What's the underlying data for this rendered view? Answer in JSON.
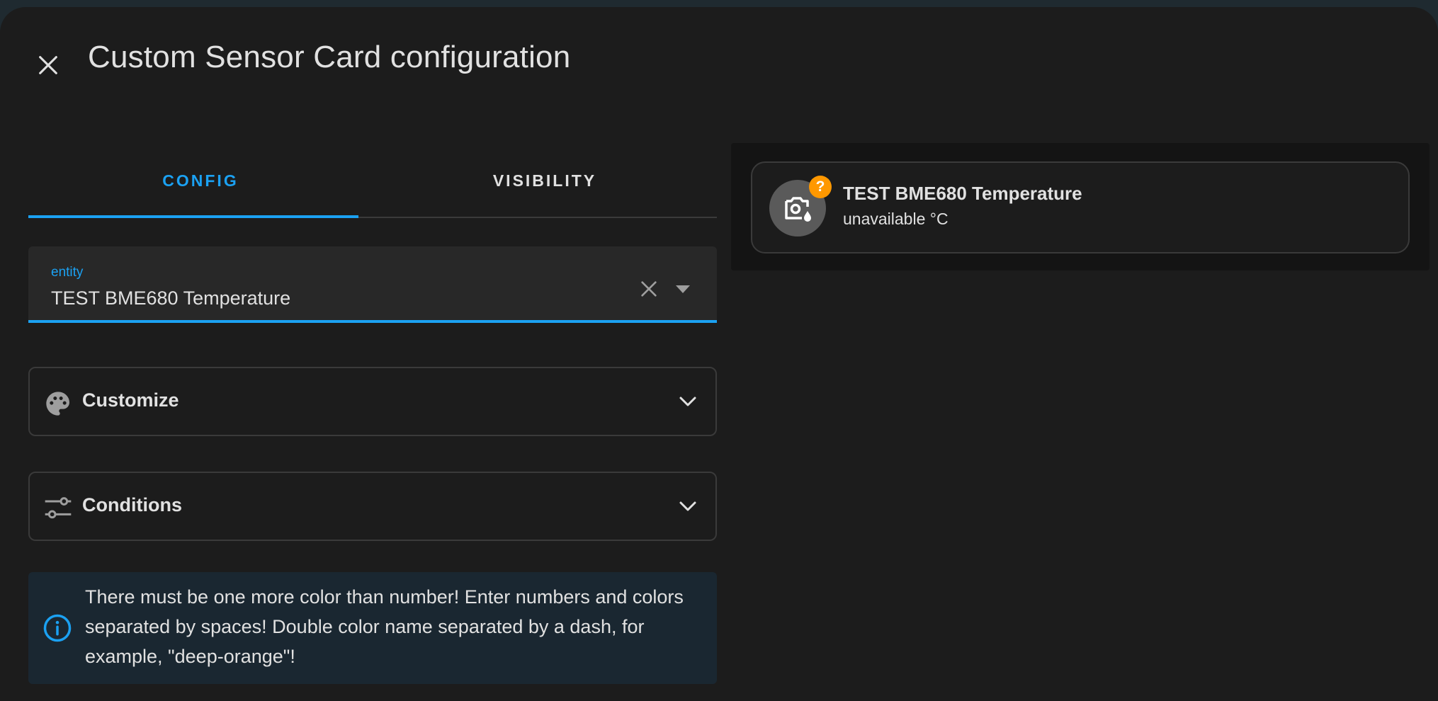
{
  "dialog": {
    "title": "Custom Sensor Card configuration",
    "close_icon": "close-icon"
  },
  "tabs": [
    {
      "label": "CONFIG",
      "active": true
    },
    {
      "label": "VISIBILITY",
      "active": false
    }
  ],
  "entity_field": {
    "label": "entity",
    "value": "TEST BME680 Temperature",
    "clear_icon": "close-icon",
    "dropdown_icon": "triangle-down-icon"
  },
  "sections": [
    {
      "label": "Customize",
      "icon": "palette-icon",
      "expanded": false
    },
    {
      "label": "Conditions",
      "icon": "tune-icon",
      "expanded": false
    }
  ],
  "info": {
    "text": "There must be one more color than number! Enter numbers and colors separated by spaces! Double color name separated by a dash, for example, \"deep-orange\"!",
    "icon": "info-circle-icon"
  },
  "preview": {
    "name": "TEST BME680 Temperature",
    "state": "unavailable °C",
    "badge": "?",
    "icon": "thermometer-camera-icon"
  },
  "colors": {
    "accent": "#1ba1f2",
    "badge": "#ff9800",
    "background": "#1c1c1c"
  }
}
